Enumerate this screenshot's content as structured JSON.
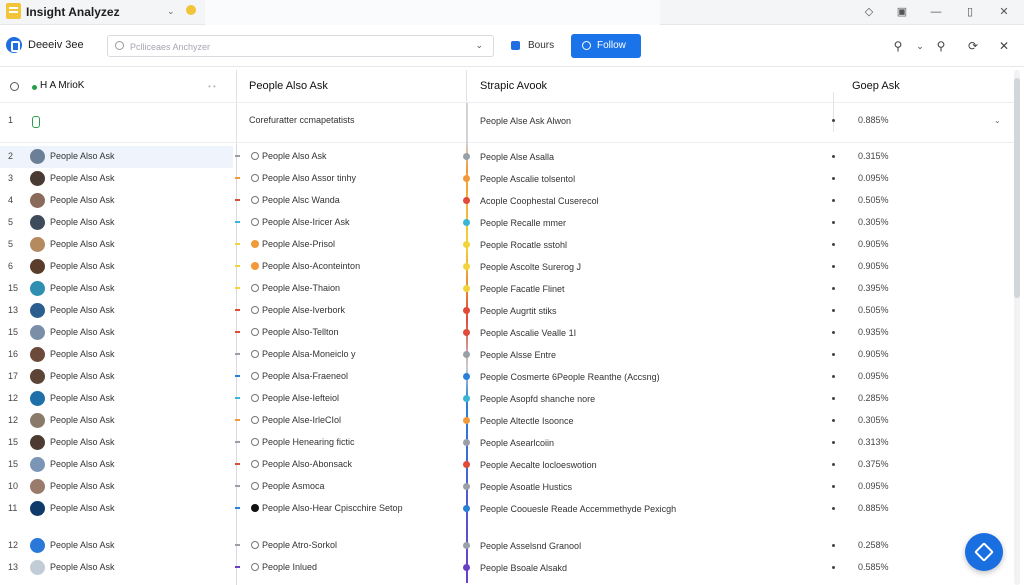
{
  "app": {
    "title": "Insight Analyzez"
  },
  "toolbar": {
    "brand": "Deeeiv 3ee",
    "search_placeholder": "Pclliceaes Anchyzer",
    "bours_label": "Bours",
    "follow_label": "Follow"
  },
  "columns": {
    "col1": "H A MrioK",
    "col2": "People Also Ask",
    "col3": "Strapic Avook",
    "col4": "Goep Ask"
  },
  "first_row": {
    "num": "1",
    "q": "Corefuratter ccmapetatists",
    "s": "People Alse Ask Alwon",
    "pct": "0.885%"
  },
  "rows": [
    {
      "num": "2",
      "name": "People Also Ask",
      "q": "People Also Ask",
      "s": "People Alse Asalla",
      "pct": "0.315%",
      "color": "#9aa0a8",
      "qfill": ""
    },
    {
      "num": "3",
      "name": "People Also Ask",
      "q": "People Also Assor tinhy",
      "s": "People Ascalie tolsentol",
      "pct": "0.095%",
      "color": "#f29a3a",
      "qfill": ""
    },
    {
      "num": "4",
      "name": "People Also Ask",
      "q": "People Alsc Wanda",
      "s": "Acople Coophestal Cuserecol",
      "pct": "0.505%",
      "color": "#e04a3a",
      "qfill": ""
    },
    {
      "num": "5",
      "name": "People Also Ask",
      "q": "People Alse-Iricer Ask",
      "s": "People Recalle mmer",
      "pct": "0.305%",
      "color": "#3ab5d6",
      "qfill": ""
    },
    {
      "num": "5",
      "name": "People Also Ask",
      "q": "People Alse-Prisol",
      "s": "People Rocatle sstohl",
      "pct": "0.905%",
      "color": "#f2d43a",
      "qfill": "#f29a3a"
    },
    {
      "num": "6",
      "name": "People Also Ask",
      "q": "People Also-Aconteinton",
      "s": "People Ascolte Surerog J",
      "pct": "0.905%",
      "color": "#f2d43a",
      "qfill": "#f29a3a"
    },
    {
      "num": "15",
      "name": "People Also Ask",
      "q": "People Alse-Thaion",
      "s": "People Facatle Flinet",
      "pct": "0.395%",
      "color": "#f2d43a",
      "qfill": ""
    },
    {
      "num": "13",
      "name": "People Also Ask",
      "q": "People Alse-Iverbork",
      "s": "People Augrtit stiks",
      "pct": "0.505%",
      "color": "#e04a3a",
      "qfill": ""
    },
    {
      "num": "15",
      "name": "People Also Ask",
      "q": "People Also-Tellton",
      "s": "People Ascalie Vealle 1I",
      "pct": "0.935%",
      "color": "#e04a3a",
      "qfill": ""
    },
    {
      "num": "16",
      "name": "People Also Ask",
      "q": "People Alsa-Moneiclo y",
      "s": "People Alsse Entre",
      "pct": "0.905%",
      "color": "#9aa0a8",
      "qfill": ""
    },
    {
      "num": "17",
      "name": "People Also Ask",
      "q": "People Alsa-Fraeneol",
      "s": "People Cosmerte 6People Reanthe (Accsng)",
      "pct": "0.095%",
      "color": "#2a7fd6",
      "qfill": ""
    },
    {
      "num": "12",
      "name": "People Also Ask",
      "q": "People Alse-Iefteiol",
      "s": "People Asopfd shanche nore",
      "pct": "0.285%",
      "color": "#3ab5d6",
      "qfill": ""
    },
    {
      "num": "12",
      "name": "People Also Ask",
      "q": "People Alse-IrleCIol",
      "s": "People Altectle Isoonce",
      "pct": "0.305%",
      "color": "#f29a3a",
      "qfill": ""
    },
    {
      "num": "15",
      "name": "People Also Ask",
      "q": "People Henearing fictic",
      "s": "People Asearlcoiin",
      "pct": "0.313%",
      "color": "#9aa0a8",
      "qfill": ""
    },
    {
      "num": "15",
      "name": "People Also Ask",
      "q": "People Also-Abonsack",
      "s": "People Aecalte locloeswotion",
      "pct": "0.375%",
      "color": "#e04a3a",
      "qfill": ""
    },
    {
      "num": "10",
      "name": "People Also Ask",
      "q": "People Asmoca",
      "s": "People Asoatle Hustics",
      "pct": "0.095%",
      "color": "#9aa0a8",
      "qfill": ""
    },
    {
      "num": "11",
      "name": "People Also Ask",
      "q": "People Also-Hear Cpiscchire Setop",
      "s": "People Coouesle Reade Accemmethyde Pexicgh",
      "pct": "0.885%",
      "color": "#2a7fd6",
      "qfill": "#111111"
    },
    {
      "num": "12",
      "name": "People Also Ask",
      "q": "People Atro-Sorkol",
      "s": "People Asselsnd Granool",
      "pct": "0.258%",
      "color": "#9aa0a8",
      "qfill": ""
    },
    {
      "num": "13",
      "name": "People Also Ask",
      "q": "People Inlued",
      "s": "People Bsoale Alsakd",
      "pct": "0.585%",
      "color": "#6a3fc7",
      "qfill": ""
    }
  ],
  "avatar_colors": [
    "#6b7f96",
    "#4a3a34",
    "#8a6a5a",
    "#3d4b5c",
    "#b58a5e",
    "#5a3c2c",
    "#2f8fb0",
    "#2c5d8f",
    "#7a8ea8",
    "#6b4a3a",
    "#5c4436",
    "#1f6fa8",
    "#8a7a6a",
    "#4d3a30",
    "#7a95b5",
    "#9a7a6a",
    "#0f3a6a",
    "#2a78d8",
    "#c2ccd6"
  ]
}
